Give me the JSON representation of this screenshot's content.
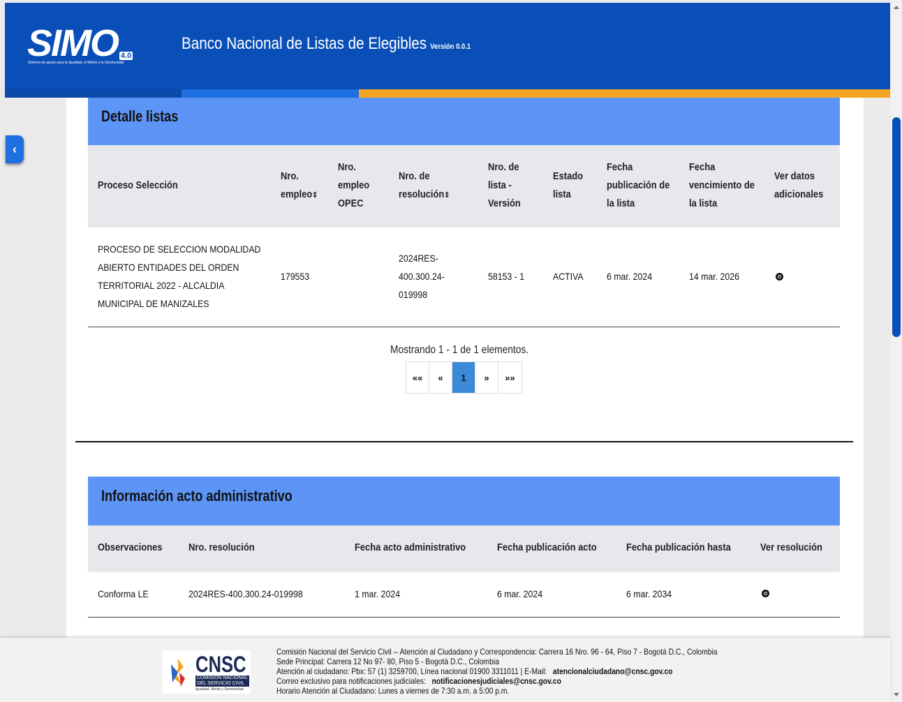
{
  "header": {
    "logo_text": "SIMO",
    "logo_version": "4.0",
    "logo_tagline": "Sistema de apoyo para la Igualdad, el Mérito y la Oportunidad",
    "title": "Banco Nacional de Listas de Elegibles",
    "version": "Versión 0.0.1"
  },
  "sidebar_toggle": "‹",
  "detalle": {
    "title": "Detalle listas",
    "columns": {
      "proceso": "Proceso Selección",
      "empleo_l1": "Nro.",
      "empleo_l2": "empleo",
      "opec_l1": "Nro.",
      "opec_l2": "empleo",
      "opec_l3": "OPEC",
      "resol_l1": "Nro. de",
      "resol_l2": "resolución",
      "lista_l1": "Nro. de",
      "lista_l2": "lista -",
      "lista_l3": "Versión",
      "estado_l1": "Estado",
      "estado_l2": "lista",
      "fpub_l1": "Fecha",
      "fpub_l2": "publicación de",
      "fpub_l3": "la lista",
      "fven_l1": "Fecha",
      "fven_l2": "vencimiento de",
      "fven_l3": "la lista",
      "ver_l1": "Ver datos",
      "ver_l2": "adicionales",
      "sort_icon": "⇕"
    },
    "rows": [
      {
        "proceso_l1": "PROCESO DE SELECCION MODALIDAD",
        "proceso_l2": "ABIERTO ENTIDADES DEL ORDEN",
        "proceso_l3": "TERRITORIAL 2022 - ALCALDIA",
        "proceso_l4": "MUNICIPAL DE MANIZALES",
        "empleo": "179553",
        "opec": "",
        "resol_l1": "2024RES-",
        "resol_l2": "400.300.24-",
        "resol_l3": "019998",
        "lista": "58153 - 1",
        "estado": "ACTIVA",
        "fecha_pub": "6 mar. 2024",
        "fecha_ven": "14 mar. 2026"
      }
    ],
    "pager": {
      "summary": "Mostrando 1 - 1 de 1 elementos.",
      "first": "««",
      "prev": "«",
      "current": "1",
      "next": "»",
      "last": "»»"
    }
  },
  "acto": {
    "title": "Información acto administrativo",
    "columns": {
      "obs": "Observaciones",
      "resol": "Nro. resolución",
      "fecha_acto": "Fecha acto administrativo",
      "fecha_pub": "Fecha publicación acto",
      "fecha_hasta": "Fecha publicación hasta",
      "ver": "Ver resolución"
    },
    "rows": [
      {
        "obs": "Conforma LE",
        "resol": "2024RES-400.300.24-019998",
        "fecha_acto": "1 mar. 2024",
        "fecha_pub": "6 mar. 2024",
        "fecha_hasta": "6 mar. 2034"
      }
    ]
  },
  "footer": {
    "logo_name": "CNSC",
    "logo_sub1": "COMISIÓN NACIONAL",
    "logo_sub1b": "DEL SERVICIO CIVIL",
    "logo_sub2": "Igualdad, Mérito y Oportunidad",
    "line1": "Comisión Nacional del Servicio Civil -- Atención al Ciudadano y Correspondencia: Carrera 16 Nro. 96 - 64, Piso 7 - Bogotá D.C., Colombia",
    "line2": "Sede Principal: Carrera 12 No 97- 80, Piso 5 - Bogotá D.C., Colombia",
    "line3": "Atención al ciudadano: Pbx: 57 (1) 3259700, Línea nacional 01900 3311011 | E-Mail:",
    "line3_email": "atencionalciudadano@cnsc.gov.co",
    "line4": "Correo exclusivo para notificaciones judiciales:",
    "line4_email": "notificacionesjudiciales@cnsc.gov.co",
    "line5": "Horario Atención al Ciudadano:  Lunes a viernes de 7:30 a.m. a 5:00 p.m."
  },
  "colors": {
    "header_blue": "#0a4fb8",
    "section_blue": "#5c95f5",
    "accent_orange": "#f4a623",
    "pager_active": "#3b8ad8"
  }
}
